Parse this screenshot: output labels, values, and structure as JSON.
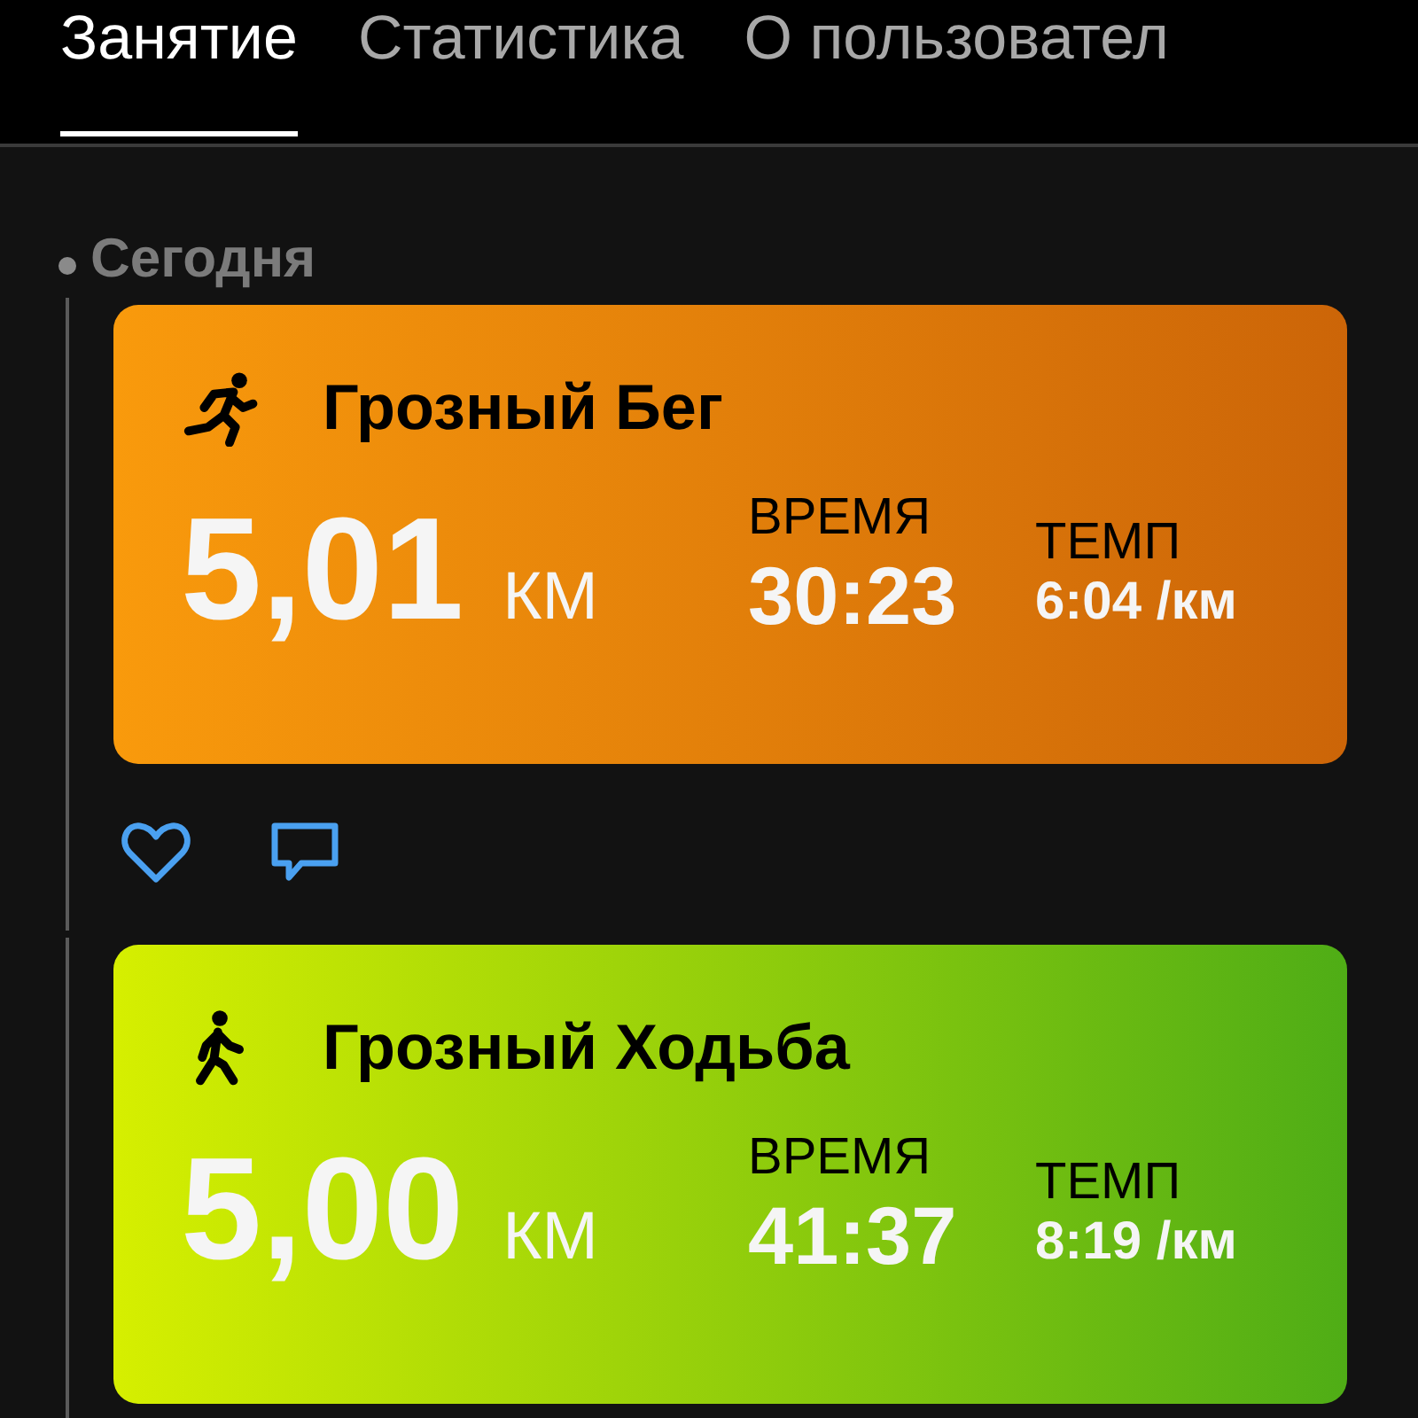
{
  "tabs": [
    {
      "label": "Занятие",
      "selected": true
    },
    {
      "label": "Статистика",
      "selected": false
    },
    {
      "label": "О пользовател",
      "selected": false
    }
  ],
  "day": "Сегодня",
  "activities": [
    {
      "kind": "run",
      "title": "Грозный Бег",
      "distance": "5,01",
      "unit": "КМ",
      "time_label": "ВРЕМЯ",
      "time": "30:23",
      "pace_label": "ТЕМП",
      "pace": "6:04 /км",
      "actions": [
        {
          "kind": "like"
        },
        {
          "kind": "comment"
        }
      ]
    },
    {
      "kind": "walk",
      "title": "Грозный Ходьба",
      "distance": "5,00",
      "unit": "КМ",
      "time_label": "ВРЕМЯ",
      "time": "41:37",
      "pace_label": "ТЕМП",
      "pace": "8:19 /км"
    }
  ]
}
